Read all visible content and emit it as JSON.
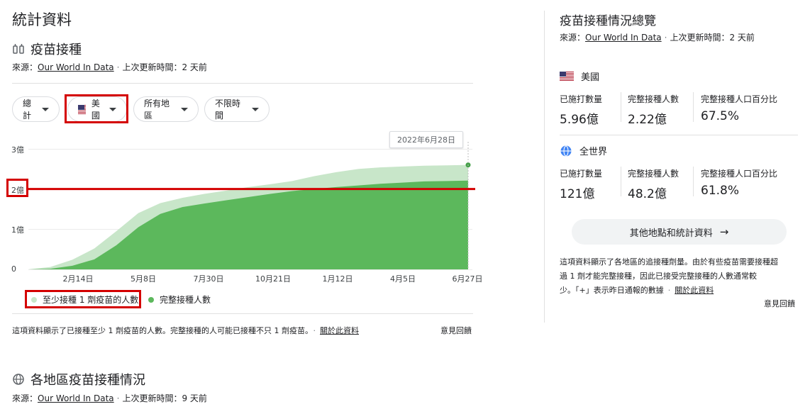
{
  "left": {
    "page_title": "統計資料",
    "section_title": "疫苗接種",
    "source_prefix": "來源：",
    "source_link": "Our World In Data",
    "updated": "上次更新時間：2 天前",
    "filters": {
      "metric": "總計",
      "country": "美國",
      "region": "所有地區",
      "time": "不限時間"
    },
    "tooltip_date": "2022年6月28日",
    "legend": {
      "series1": "至少接種 1 劑疫苗的人數",
      "series2": "完整接種人數"
    },
    "note": "這項資料顯示了已接種至少 1 劑疫苗的人數。完整接種的人可能已接種不只 1 劑疫苗。",
    "about_link": "關於此資料",
    "feedback": "意見回饋"
  },
  "chart_data": {
    "type": "area",
    "title": "",
    "xlabel": "",
    "ylabel": "",
    "y_tick_labels": [
      "0",
      "1億",
      "2億",
      "3億"
    ],
    "ylim": [
      0,
      300000000
    ],
    "x_tick_labels": [
      "2月14日",
      "5月8日",
      "7月30日",
      "10月21日",
      "1月12日",
      "4月5日",
      "6月27日"
    ],
    "x": [
      0,
      0.05,
      0.1,
      0.15,
      0.2,
      0.25,
      0.3,
      0.35,
      0.4,
      0.45,
      0.5,
      0.55,
      0.6,
      0.65,
      0.7,
      0.75,
      0.8,
      0.85,
      0.9,
      0.95,
      1.0
    ],
    "series": [
      {
        "name": "至少接種 1 劑疫苗的人數",
        "color": "#c8e6c9",
        "values": [
          0,
          6000000,
          24000000,
          52000000,
          95000000,
          140000000,
          165000000,
          178000000,
          188000000,
          196000000,
          205000000,
          212000000,
          220000000,
          232000000,
          242000000,
          250000000,
          254000000,
          256000000,
          258000000,
          259000000,
          260000000
        ]
      },
      {
        "name": "完整接種人數",
        "color": "#5cb85c",
        "values": [
          0,
          1500000,
          9000000,
          25000000,
          60000000,
          105000000,
          138000000,
          155000000,
          164000000,
          172000000,
          180000000,
          188000000,
          195000000,
          200000000,
          205000000,
          209000000,
          213000000,
          216000000,
          219000000,
          220000000,
          221000000
        ]
      }
    ],
    "grid": true,
    "legend_position": "bottom-left",
    "highlight_line_value": 200000000
  },
  "right": {
    "title": "疫苗接種情況總覽",
    "source_prefix": "來源：",
    "source_link": "Our World In Data",
    "updated": "上次更新時間：2 天前",
    "us": {
      "name": "美國",
      "label1": "已施打數量",
      "value1": "5.96億",
      "label2": "完整接種人數",
      "value2": "2.22億",
      "label3": "完整接種人口百分比",
      "value3": "67.5%"
    },
    "world": {
      "name": "全世界",
      "label1": "已施打數量",
      "value1": "121億",
      "label2": "完整接種人數",
      "value2": "48.2億",
      "label3": "完整接種人口百分比",
      "value3": "61.8%"
    },
    "more_button": "其他地點和統計資料",
    "note_line1": "這項資料顯示了各地區的追接種劑量。由於有些疫苗需要接種超",
    "note_line2": "過 1 劑才能完整接種，因此已接受完整接種的人數通常較",
    "note_line3": "少。「+」表示昨日通報的數據",
    "about_link": "關於此資料",
    "feedback": "意見回饋"
  },
  "bottom": {
    "title": "各地區疫苗接種情況",
    "source_prefix": "來源：",
    "source_link": "Our World In Data",
    "updated": "上次更新時間：9 天前"
  }
}
